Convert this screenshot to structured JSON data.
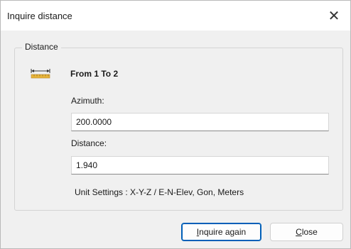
{
  "window": {
    "title": "Inquire distance",
    "close_glyph": "✕"
  },
  "group": {
    "legend": "Distance",
    "icon": "ruler-icon",
    "heading": "From 1 To 2"
  },
  "azimuth": {
    "label": "Azimuth:",
    "value": "200.0000"
  },
  "distance": {
    "label": "Distance:",
    "value": "1.940"
  },
  "units_text": "Unit Settings : X-Y-Z / E-N-Elev, Gon, Meters",
  "buttons": {
    "inquire_again": {
      "first": "I",
      "rest": "nquire again"
    },
    "close": {
      "first": "C",
      "rest": "lose"
    }
  },
  "colors": {
    "accent": "#005fb8",
    "ruler_yellow": "#e8b53a"
  }
}
